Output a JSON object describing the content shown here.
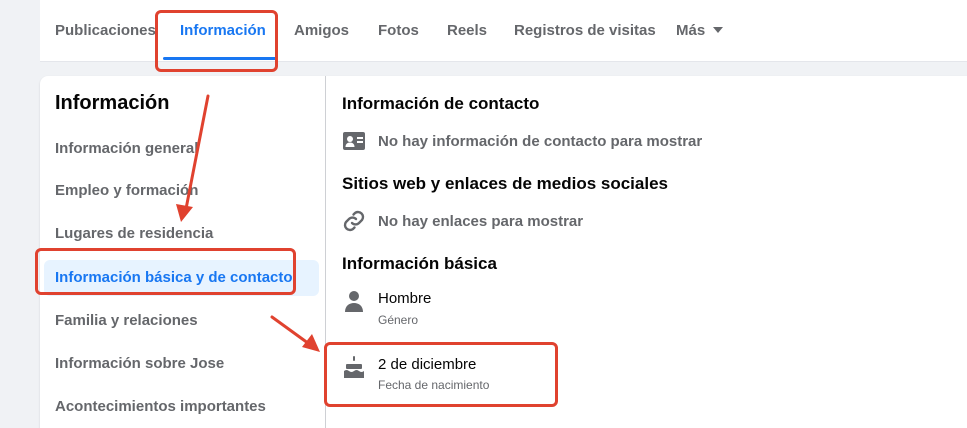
{
  "tabs": [
    {
      "label": "Publicaciones"
    },
    {
      "label": "Información"
    },
    {
      "label": "Amigos"
    },
    {
      "label": "Fotos"
    },
    {
      "label": "Reels"
    },
    {
      "label": "Registros de visitas"
    },
    {
      "label": "Más"
    }
  ],
  "sidebar": {
    "title": "Información",
    "items": [
      {
        "label": "Información general"
      },
      {
        "label": "Empleo y formación"
      },
      {
        "label": "Lugares de residencia"
      },
      {
        "label": "Información básica y de contacto"
      },
      {
        "label": "Familia y relaciones"
      },
      {
        "label": "Información sobre Jose"
      },
      {
        "label": "Acontecimientos importantes"
      }
    ]
  },
  "content": {
    "contact_title": "Información de contacto",
    "contact_empty": "No hay información de contacto para mostrar",
    "websites_title": "Sitios web y enlaces de medios sociales",
    "websites_empty": "No hay enlaces para mostrar",
    "basic_title": "Información básica",
    "gender_value": "Hombre",
    "gender_label": "Género",
    "birth_value": "2 de diciembre",
    "birth_label": "Fecha de nacimiento"
  },
  "colors": {
    "accent": "#1877f2",
    "annotation": "#e0422f",
    "active_bg": "#e7f3ff",
    "muted_text": "#65676b"
  }
}
